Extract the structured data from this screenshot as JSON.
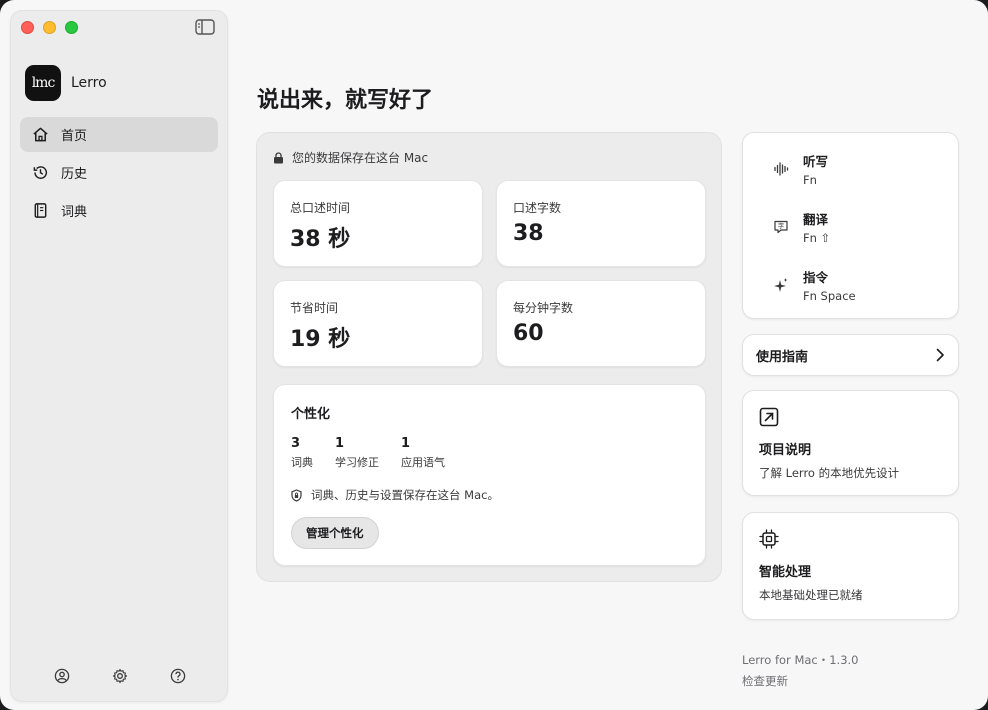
{
  "app": {
    "name": "Lerro",
    "logo_text": "lmc"
  },
  "sidebar": {
    "items": [
      {
        "label": "首页",
        "icon": "home-icon",
        "active": true
      },
      {
        "label": "历史",
        "icon": "history-icon",
        "active": false
      },
      {
        "label": "词典",
        "icon": "dictionary-icon",
        "active": false
      }
    ],
    "bottom_icons": [
      "account-icon",
      "settings-icon",
      "help-icon"
    ]
  },
  "main": {
    "title": "说出来，就写好了",
    "privacy_note": "您的数据保存在这台 Mac",
    "stats": [
      {
        "label": "总口述时间",
        "value": "38 秒"
      },
      {
        "label": "口述字数",
        "value": "38"
      },
      {
        "label": "节省时间",
        "value": "19 秒"
      },
      {
        "label": "每分钟字数",
        "value": "60"
      }
    ],
    "personalization": {
      "title": "个性化",
      "metrics": [
        {
          "number": "3",
          "label": "词典"
        },
        {
          "number": "1",
          "label": "学习修正"
        },
        {
          "number": "1",
          "label": "应用语气"
        }
      ],
      "note": "词典、历史与设置保存在这台 Mac。",
      "button_label": "管理个性化"
    }
  },
  "right": {
    "shortcuts": [
      {
        "name": "听写",
        "key": "Fn",
        "icon": "waveform-icon"
      },
      {
        "name": "翻译",
        "key": "Fn ⇧",
        "icon": "translate-icon"
      },
      {
        "name": "指令",
        "key": "Fn Space",
        "icon": "sparkle-icon"
      }
    ],
    "guide_label": "使用指南",
    "project": {
      "title": "项目说明",
      "desc": "了解 Lerro 的本地优先设计",
      "icon": "external-link-icon"
    },
    "smart": {
      "title": "智能处理",
      "desc": "本地基础处理已就绪",
      "icon": "chip-icon"
    },
    "footer": {
      "version": "Lerro for Mac・1.3.0",
      "update": "检查更新"
    }
  }
}
